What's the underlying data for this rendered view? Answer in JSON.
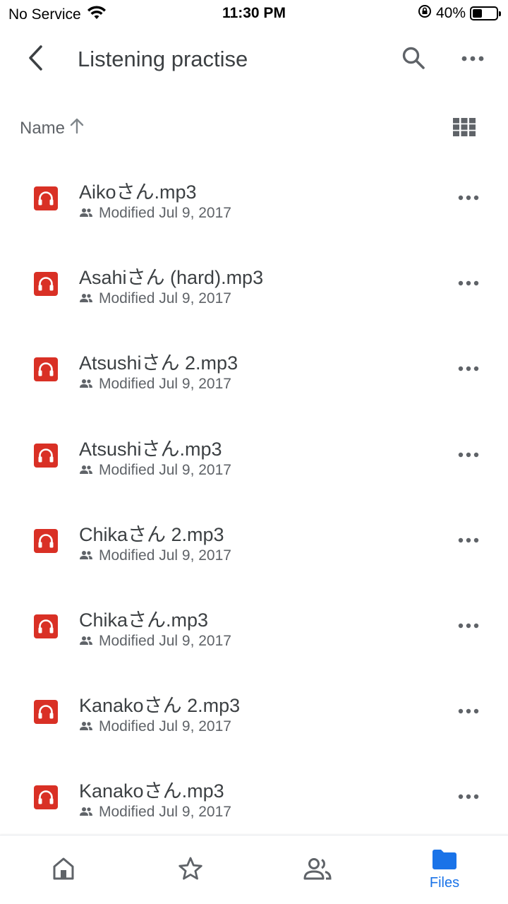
{
  "status_bar": {
    "carrier": "No Service",
    "time": "11:30 PM",
    "battery": "40%",
    "battery_level": 0.4
  },
  "header": {
    "title": "Listening practise",
    "back_icon": "chevron-left-icon",
    "search_icon": "search-icon",
    "more_icon": "more-horizontal-icon"
  },
  "sort": {
    "label": "Name",
    "direction_icon": "arrow-up-icon",
    "view_icon": "grid-view-icon"
  },
  "files": [
    {
      "name": "Aikoさん.mp3",
      "meta": "Modified Jul 9, 2017"
    },
    {
      "name": "Asahiさん (hard).mp3",
      "meta": "Modified Jul 9, 2017"
    },
    {
      "name": "Atsushiさん 2.mp3",
      "meta": "Modified Jul 9, 2017"
    },
    {
      "name": "Atsushiさん.mp3",
      "meta": "Modified Jul 9, 2017"
    },
    {
      "name": "Chikaさん 2.mp3",
      "meta": "Modified Jul 9, 2017"
    },
    {
      "name": "Chikaさん.mp3",
      "meta": "Modified Jul 9, 2017"
    },
    {
      "name": "Kanakoさん 2.mp3",
      "meta": "Modified Jul 9, 2017"
    },
    {
      "name": "Kanakoさん.mp3",
      "meta": "Modified Jul 9, 2017"
    }
  ],
  "bottom_nav": {
    "items": [
      {
        "icon": "home-icon"
      },
      {
        "icon": "star-icon"
      },
      {
        "icon": "shared-people-icon"
      },
      {
        "icon": "folder-icon",
        "label": "Files"
      }
    ]
  },
  "colors": {
    "accent": "#1a73e8",
    "audio_icon": "#d93025",
    "secondary_text": "#5f6368"
  }
}
